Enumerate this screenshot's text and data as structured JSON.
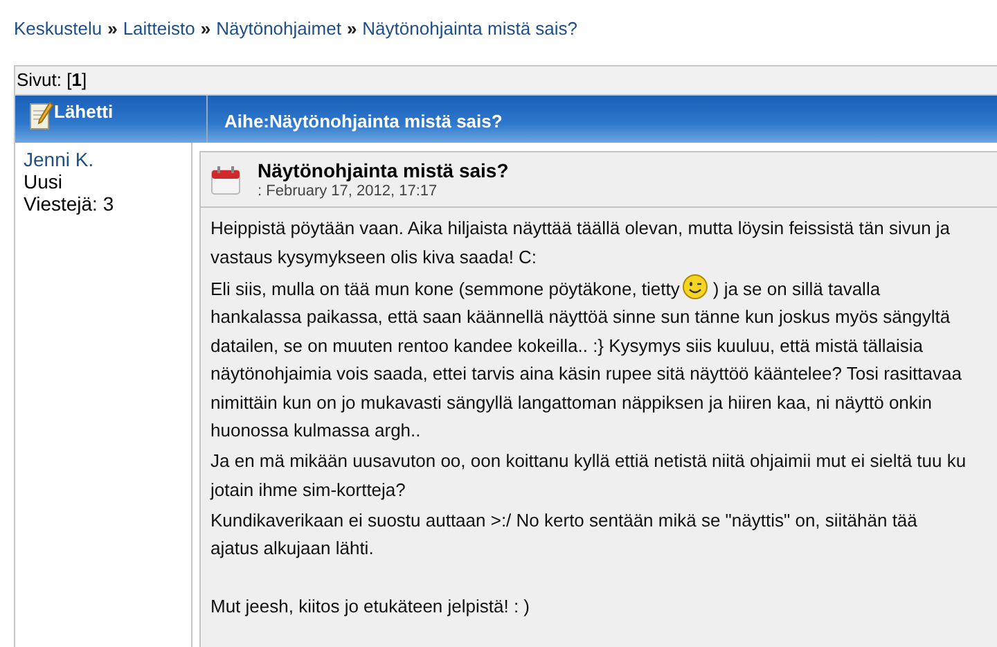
{
  "breadcrumb": [
    "Keskustelu",
    "Laitteisto",
    "Näytönohjaimet",
    "Näytönohjainta mistä sais?"
  ],
  "breadcrumb_separator": "»",
  "pages": {
    "label": "Sivut: [",
    "current": "1",
    "end": "]"
  },
  "header": {
    "author_column": "Lähetti",
    "subject": "Aihe:Näytönohjainta mistä sais?"
  },
  "post": {
    "author": "Jenni K.",
    "rank": "Uusi",
    "post_count": "Viestejä: 3",
    "title": "Näytönohjainta mistä sais?",
    "date": ": February 17, 2012, 17:17",
    "paragraphs": [
      {
        "kind": "text",
        "text": "Heippistä pöytään vaan. Aika hiljaista näyttää täällä olevan, mutta löysin feissistä tän sivun ja vastaus kysymykseen olis kiva saada! C:"
      },
      {
        "kind": "smiley",
        "before": "Eli siis, mulla on tää mun kone (semmone pöytäkone, tietty",
        "after": ") ja se on sillä tavalla hankalassa paikassa, että saan käännellä näyttöä sinne sun tänne kun joskus myös sängyltä datailen, se on muuten rentoo kandee kokeilla.. :} Kysymys siis kuuluu, että mistä tällaisia näytönohjaimia vois saada, ettei tarvis aina käsin rupee sitä näyttöö kääntelee? Tosi rasittavaa nimittäin kun on jo mukavasti sängyllä langattoman näppiksen ja hiiren kaa, ni näyttö onkin huonossa kulmassa argh.."
      },
      {
        "kind": "text",
        "text": "Ja en mä mikään uusavuton oo, oon koittanu kyllä ettiä netistä niitä ohjaimii mut ei sieltä tuu ku jotain ihme sim-kortteja?"
      },
      {
        "kind": "text",
        "text": "Kundikaverikaan ei suostu auttaan >:/ No kerto sentään mikä se \"näyttis\" on, siitähän tää ajatus alkujaan lähti."
      },
      {
        "kind": "gap"
      },
      {
        "kind": "text",
        "text": "Mut jeesh, kiitos jo etukäteen jelpistä! : )"
      }
    ]
  }
}
